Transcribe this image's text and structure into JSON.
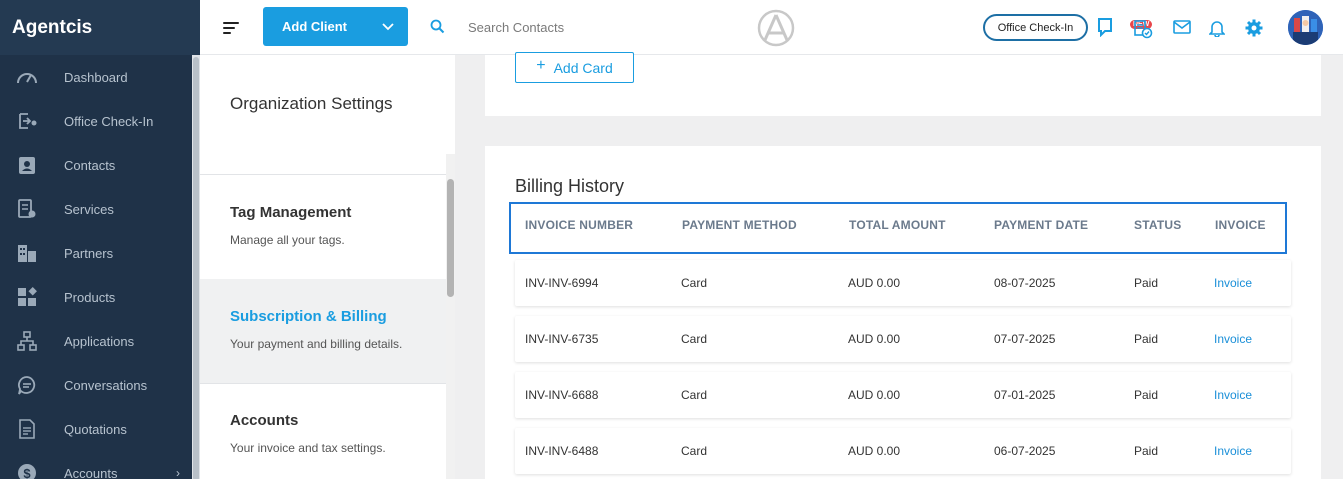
{
  "app": {
    "brand": "Agentcis"
  },
  "sidebar": {
    "items": [
      {
        "label": "Dashboard",
        "icon": "dashboard-icon"
      },
      {
        "label": "Office Check-In",
        "icon": "check-in-icon"
      },
      {
        "label": "Contacts",
        "icon": "contacts-icon"
      },
      {
        "label": "Services",
        "icon": "services-icon"
      },
      {
        "label": "Partners",
        "icon": "partners-icon"
      },
      {
        "label": "Products",
        "icon": "products-icon"
      },
      {
        "label": "Applications",
        "icon": "applications-icon"
      },
      {
        "label": "Conversations",
        "icon": "conversations-icon"
      },
      {
        "label": "Quotations",
        "icon": "quotations-icon"
      },
      {
        "label": "Accounts",
        "icon": "accounts-icon",
        "caret": "›"
      }
    ]
  },
  "topbar": {
    "add_client_label": "Add Client",
    "search_placeholder": "Search Contacts",
    "office_checkin_label": "Office Check-In",
    "new_badge": "NEW"
  },
  "settings": {
    "title": "Organization Settings",
    "items": [
      {
        "title": "Tag Management",
        "desc": "Manage all your tags."
      },
      {
        "title": "Subscription & Billing",
        "desc": "Your payment and billing details.",
        "active": true
      },
      {
        "title": "Accounts",
        "desc": "Your invoice and tax settings."
      }
    ]
  },
  "payment_card": {
    "add_card_label": "Add Card"
  },
  "billing": {
    "title": "Billing History",
    "columns": [
      "INVOICE NUMBER",
      "PAYMENT METHOD",
      "TOTAL AMOUNT",
      "PAYMENT DATE",
      "STATUS",
      "INVOICE"
    ],
    "rows": [
      {
        "invoice_number": "INV-INV-6994",
        "method": "Card",
        "amount": "AUD 0.00",
        "date": "08-07-2025",
        "status": "Paid",
        "invoice": "Invoice"
      },
      {
        "invoice_number": "INV-INV-6735",
        "method": "Card",
        "amount": "AUD 0.00",
        "date": "07-07-2025",
        "status": "Paid",
        "invoice": "Invoice"
      },
      {
        "invoice_number": "INV-INV-6688",
        "method": "Card",
        "amount": "AUD 0.00",
        "date": "07-01-2025",
        "status": "Paid",
        "invoice": "Invoice"
      },
      {
        "invoice_number": "INV-INV-6488",
        "method": "Card",
        "amount": "AUD 0.00",
        "date": "06-07-2025",
        "status": "Paid",
        "invoice": "Invoice"
      }
    ]
  },
  "colors": {
    "sidebar": "#1f3248",
    "accent": "#1a9de0",
    "highlight_border": "#1e78d6",
    "badge": "#e8474c"
  }
}
